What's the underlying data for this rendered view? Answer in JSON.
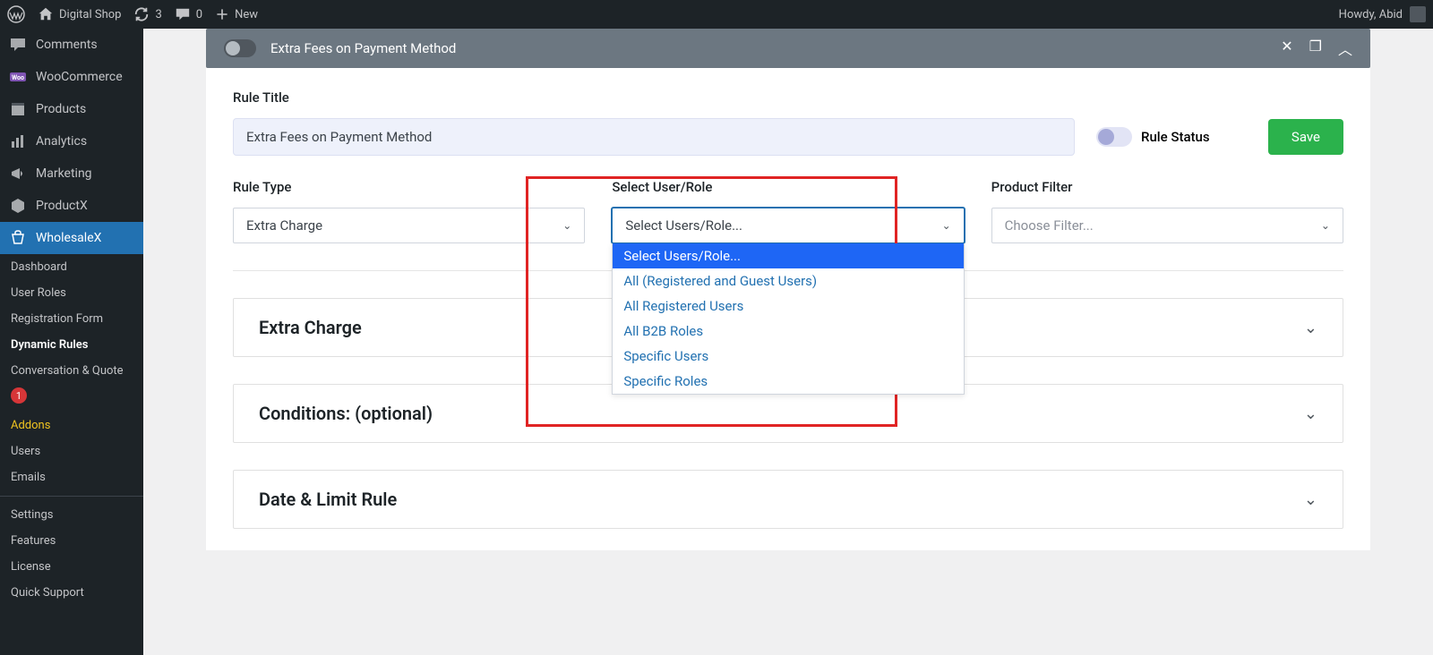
{
  "adminbar": {
    "site_name": "Digital Shop",
    "updates": "3",
    "comments": "0",
    "new": "New",
    "howdy": "Howdy, Abid"
  },
  "sidebar": {
    "items": [
      {
        "label": "Comments"
      },
      {
        "label": "WooCommerce"
      },
      {
        "label": "Products"
      },
      {
        "label": "Analytics"
      },
      {
        "label": "Marketing"
      },
      {
        "label": "ProductX"
      },
      {
        "label": "WholesaleX",
        "active": true
      }
    ],
    "submenu": {
      "dashboard": "Dashboard",
      "user_roles": "User Roles",
      "registration_form": "Registration Form",
      "dynamic_rules": "Dynamic Rules",
      "conversation_quote": "Conversation & Quote",
      "badge": "1",
      "addons": "Addons",
      "users": "Users",
      "emails": "Emails",
      "settings": "Settings",
      "features": "Features",
      "license": "License",
      "quick_support": "Quick Support"
    }
  },
  "header": {
    "title": "Extra Fees on Payment Method"
  },
  "form": {
    "rule_title_label": "Rule Title",
    "rule_title_value": "Extra Fees on Payment Method",
    "rule_status_label": "Rule Status",
    "save": "Save",
    "rule_type_label": "Rule Type",
    "rule_type_value": "Extra Charge",
    "select_user_label": "Select User/Role",
    "select_user_value": "Select Users/Role...",
    "product_filter_label": "Product Filter",
    "product_filter_value": "Choose Filter...",
    "dropdown_options": [
      "Select Users/Role...",
      "All (Registered and Guest Users)",
      "All Registered Users",
      "All B2B Roles",
      "Specific Users",
      "Specific Roles"
    ]
  },
  "accordions": {
    "extra_charge": "Extra Charge",
    "conditions": "Conditions: (optional)",
    "date_limit": "Date & Limit Rule"
  }
}
